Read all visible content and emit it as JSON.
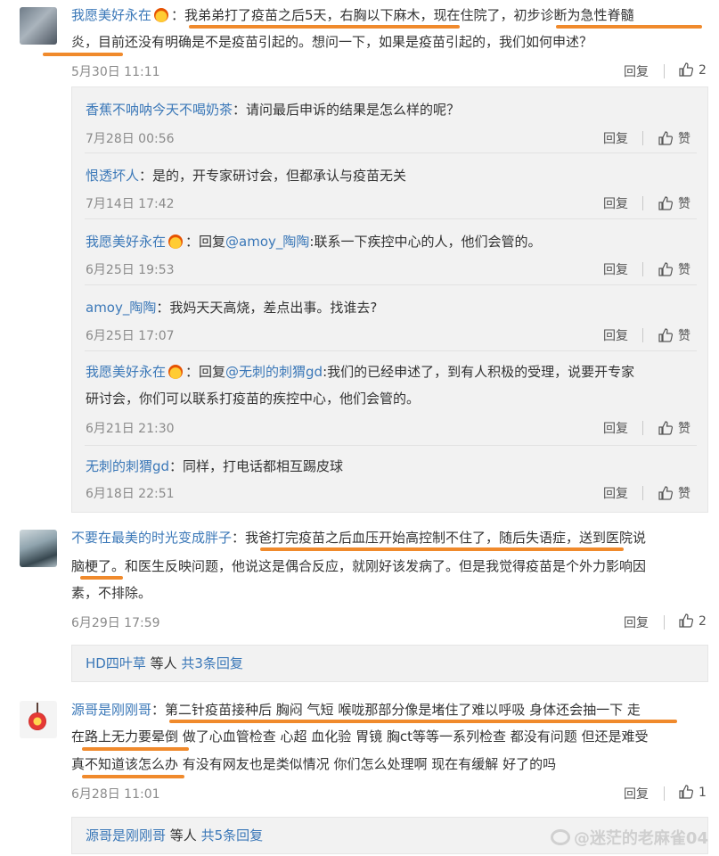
{
  "comments": [
    {
      "user": "我愿美好永在",
      "text_line1": "：我弟弟打了疫苗之后5天，右胸以下麻木，现在住院了，初步诊断为急性脊髓",
      "text_line2": "炎，目前还没有明确是不是疫苗引起的。想问一下，如果是疫苗引起的，我们如何申述？",
      "time": "5月30日 11:11",
      "reply_label": "回复",
      "likes": "2",
      "replies": [
        {
          "user": "香蕉不呐呐今天不喝奶茶",
          "text": "：请问最后申诉的结果是怎么样的呢？",
          "time": "7月28日 00:56",
          "reply_label": "回复",
          "like_label": "赞"
        },
        {
          "user": "恨透坏人",
          "text": "：是的，开专家研讨会，但都承认与疫苗无关",
          "time": "7月14日 17:42",
          "reply_label": "回复",
          "like_label": "赞"
        },
        {
          "user": "我愿美好永在",
          "pre": "：回复",
          "mention": "@amoy_陶陶",
          "text": ":联系一下疾控中心的人，他们会管的。",
          "time": "6月25日 19:53",
          "reply_label": "回复",
          "like_label": "赞"
        },
        {
          "user": "amoy_陶陶",
          "text": "：我妈天天高烧，差点出事。找谁去?",
          "time": "6月25日 17:07",
          "reply_label": "回复",
          "like_label": "赞"
        },
        {
          "user": "我愿美好永在",
          "pre": "：回复",
          "mention": "@无刺的刺猬gd",
          "text": ":我们的已经申述了，到有人积极的受理，说要开专家",
          "text2": "研讨会，你们可以联系打疫苗的疾控中心，他们会管的。",
          "time": "6月21日 21:30",
          "reply_label": "回复",
          "like_label": "赞"
        },
        {
          "user": "无刺的刺猬gd",
          "text": "：同样，打电话都相互踢皮球",
          "time": "6月18日 22:51",
          "reply_label": "回复",
          "like_label": "赞"
        }
      ]
    },
    {
      "user": "不要在最美的时光变成胖子",
      "text_line1": "：我爸打完疫苗之后血压开始高控制不住了，随后失语症，送到医院说",
      "text_line2": "脑梗了。和医生反映问题，他说这是偶合反应，就刚好该发病了。但是我觉得疫苗是个外力影响因",
      "text_line3": "素，不排除。",
      "time": "6月29日 17:59",
      "reply_label": "回复",
      "likes": "2",
      "more_user": "HD四叶草",
      "more_mid": " 等人 ",
      "more_link": "共3条回复"
    },
    {
      "user": "源哥是刚刚哥",
      "text_line1": "：第二针疫苗接种后 胸闷 气短 喉咙那部分像是堵住了难以呼吸 身体还会抽一下  走",
      "text_line2": "在路上无力要晕倒 做了心血管检查 心超 血化验 胃镜  胸ct等等一系列检查 都没有问题 但还是难受",
      "text_line3": "真不知道该怎么办 有没有网友也是类似情况 你们怎么处理啊 现在有缓解 好了的吗",
      "time": "6月28日 11:01",
      "reply_label": "回复",
      "likes": "1",
      "more_user": "源哥是刚刚哥",
      "more_mid": " 等人 ",
      "more_link": "共5条回复"
    }
  ],
  "watermark": "@迷茫的老麻雀04",
  "colors": {
    "link": "#3b78b8",
    "highlight": "#f08a2c",
    "panel": "#f2f2f2"
  }
}
